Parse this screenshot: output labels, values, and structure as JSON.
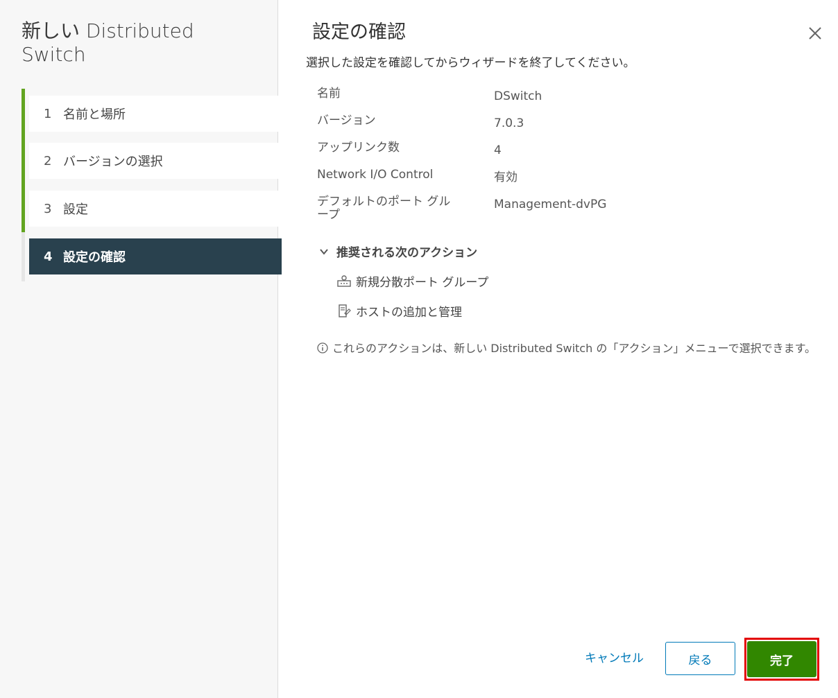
{
  "wizard": {
    "title": "新しい Distributed Switch",
    "steps": [
      {
        "num": "1",
        "label": "名前と場所"
      },
      {
        "num": "2",
        "label": "バージョンの選択"
      },
      {
        "num": "3",
        "label": "設定"
      },
      {
        "num": "4",
        "label": "設定の確認",
        "active": true
      }
    ]
  },
  "page": {
    "title": "設定の確認",
    "subtitle": "選択した設定を確認してからウィザードを終了してください。",
    "summary": [
      {
        "label": "名前",
        "value": "DSwitch"
      },
      {
        "label": "バージョン",
        "value": "7.0.3"
      },
      {
        "label": "アップリンク数",
        "value": "4"
      },
      {
        "label": "Network I/O Control",
        "value": "有効"
      },
      {
        "label": "デフォルトのポート グループ",
        "value": "Management-dvPG"
      }
    ],
    "next_actions": {
      "header": "推奨される次のアクション",
      "items": [
        {
          "icon": "port-group-icon",
          "label": "新規分散ポート グループ"
        },
        {
          "icon": "host-manage-icon",
          "label": "ホストの追加と管理"
        }
      ]
    },
    "info_note": "これらのアクションは、新しい Distributed Switch の「アクション」メニューで選択できます。"
  },
  "footer": {
    "cancel": "キャンセル",
    "back": "戻る",
    "finish": "完了"
  },
  "colors": {
    "accent": "#0079b8",
    "progress": "#62a420",
    "active_step": "#29414e",
    "finish_button": "#318700",
    "highlight": "#e30000"
  }
}
